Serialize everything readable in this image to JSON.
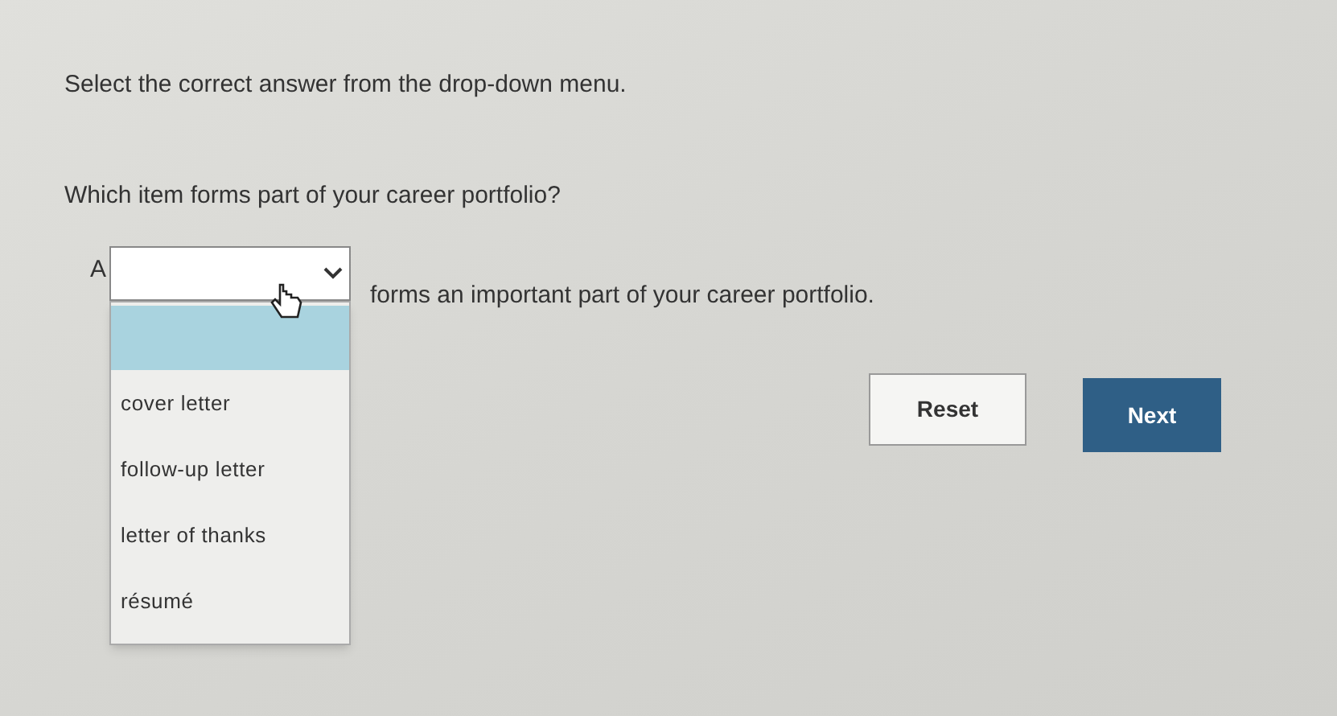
{
  "instruction": "Select the correct answer from the drop-down menu.",
  "question": "Which item forms part of your career portfolio?",
  "sentence": {
    "prefix": "A",
    "suffix": "forms an important part of your career portfolio."
  },
  "dropdown": {
    "expanded": true,
    "options": [
      {
        "label": "cover letter",
        "selected": false
      },
      {
        "label": "follow-up letter",
        "selected": false
      },
      {
        "label": "letter of thanks",
        "selected": false
      },
      {
        "label": "résumé",
        "selected": false
      }
    ]
  },
  "buttons": [
    {
      "label": "Reset",
      "kind": "secondary"
    },
    {
      "label": "Next",
      "kind": "primary"
    }
  ]
}
